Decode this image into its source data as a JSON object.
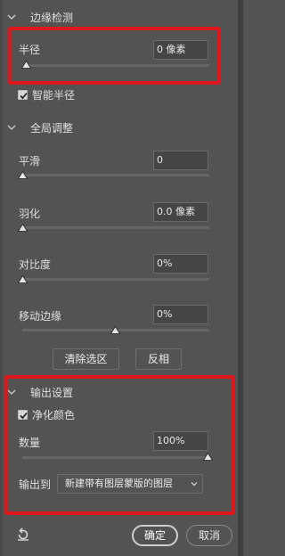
{
  "edge_detection": {
    "title": "边缘检测",
    "radius": {
      "label": "半径",
      "value": "0 像素",
      "slider_value": 0
    },
    "smart_radius": {
      "label": "智能半径",
      "checked": true
    }
  },
  "global_refine": {
    "title": "全局调整",
    "smooth": {
      "label": "平滑",
      "value": "0",
      "slider_value": 0
    },
    "feather": {
      "label": "羽化",
      "value": "0.0 像素",
      "slider_value": 0
    },
    "contrast": {
      "label": "对比度",
      "value": "0%",
      "slider_value": 0
    },
    "shift_edge": {
      "label": "移动边缘",
      "value": "0%",
      "slider_value": 0,
      "slider_min": -100,
      "slider_max": 100
    },
    "clear_selection_label": "清除选区",
    "invert_label": "反相"
  },
  "output_settings": {
    "title": "输出设置",
    "decontaminate": {
      "label": "净化颜色",
      "checked": true
    },
    "amount": {
      "label": "数量",
      "value": "100%",
      "slider_value": 100
    },
    "output_to": {
      "label": "输出到",
      "selected": "新建带有图层蒙版的图层"
    }
  },
  "footer": {
    "ok_label": "确定",
    "cancel_label": "取消",
    "reset_icon": "reset-icon"
  },
  "colors": {
    "panel_bg": "#535353",
    "highlight": "#e0171d",
    "field_bg": "#454545"
  }
}
